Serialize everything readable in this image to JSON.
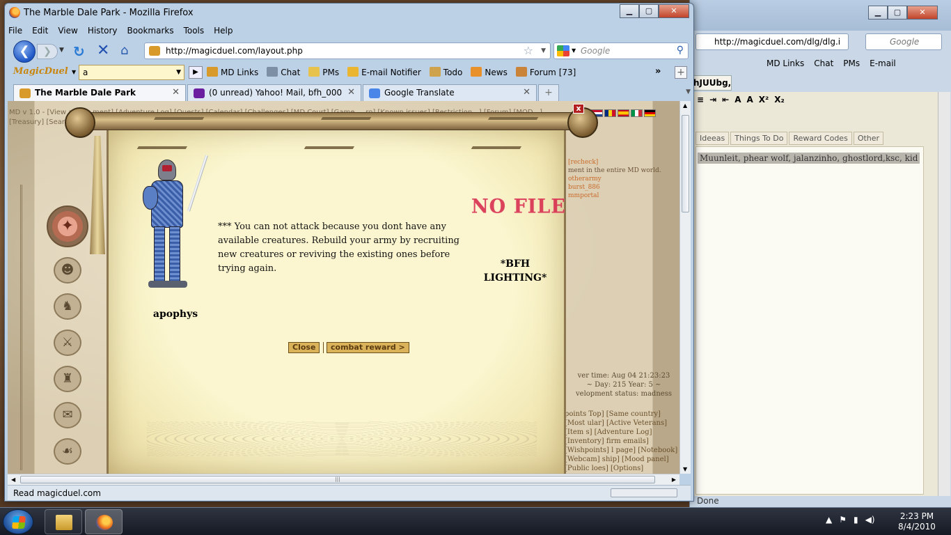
{
  "background_window": {
    "url": "http://magicduel.com/dlg/dlg.i",
    "search_placeholder": "Google",
    "toolbar": [
      "MD Links",
      "Chat",
      "PMs",
      "E-mail"
    ],
    "tab_label": "hJUUbg,,",
    "tabs": [
      "Ideeas",
      "Things To Do",
      "Reward Codes",
      "Other"
    ],
    "selected_text": "Muunleit, phear wolf, jalanzinho, ghostlord,ksc, kid",
    "status": "Done"
  },
  "window": {
    "title": "The Marble Dale Park - Mozilla Firefox",
    "buttons": {
      "minimize": "▁",
      "maximize": "▢",
      "close": "✕"
    }
  },
  "menu": [
    "File",
    "Edit",
    "View",
    "History",
    "Bookmarks",
    "Tools",
    "Help"
  ],
  "nav": {
    "url": "http://magicduel.com/layout.php",
    "search_placeholder": "Google"
  },
  "md_toolbar": {
    "logo": "MagicDuel",
    "input_value": "a",
    "items": [
      "MD Links",
      "Chat",
      "PMs",
      "E-mail Notifier",
      "Todo",
      "News",
      "Forum [73]"
    ],
    "more": "»"
  },
  "tabs": [
    {
      "label": "The Marble Dale Park",
      "active": true,
      "icon": "magicduel-favicon"
    },
    {
      "label": "(0 unread) Yahoo! Mail, bfh_000",
      "active": false,
      "icon": "yahoo-favicon"
    },
    {
      "label": "Google Translate",
      "active": false,
      "icon": "google-translate-favicon"
    }
  ],
  "game": {
    "menu_line1": "MD v 1.0 - [View and ... ment] [Adventure Log] [Quests] [Calendar] [Challenges] [MD Court] [Game ... ro] [Known issues] [Restriction...] [Forum] [MOD...]",
    "menu_line2": "[Treasury] [Search]",
    "right_info": {
      "recheck": "[recheck]",
      "line": "ment in the entire MD world.",
      "links": [
        "otherarmy",
        "burst_886",
        "mmportal"
      ]
    },
    "server_time": "ver time: Aug 04 21:23:23",
    "day_year": "~ Day: 215 Year: 5 ~",
    "dev_status": "velopment status: madness",
    "links_block": "points Top] [Same country] [Most ular] [Active Veterans] [Item s] [Adventure Log] [Inventory] firm emails] [Wishpoints] l page] [Notebook] [Webcam] ship] [Mood panel] [Public loes] [Options]"
  },
  "dialog": {
    "close_x": "x",
    "player_name": "apophys",
    "message": "*** You can not attack because you dont have any available creatures. Rebuild your army by recruiting new creatures or reviving the existing ones before trying again.",
    "opponent_image_text": "NO FILE",
    "opponent_name": "*BFH LIGHTING*",
    "close_button": "Close",
    "reward_button": "combat reward >"
  },
  "status_bar": {
    "text": "Read magicduel.com"
  },
  "taskbar": {
    "time": "2:23 PM",
    "date": "8/4/2010"
  }
}
